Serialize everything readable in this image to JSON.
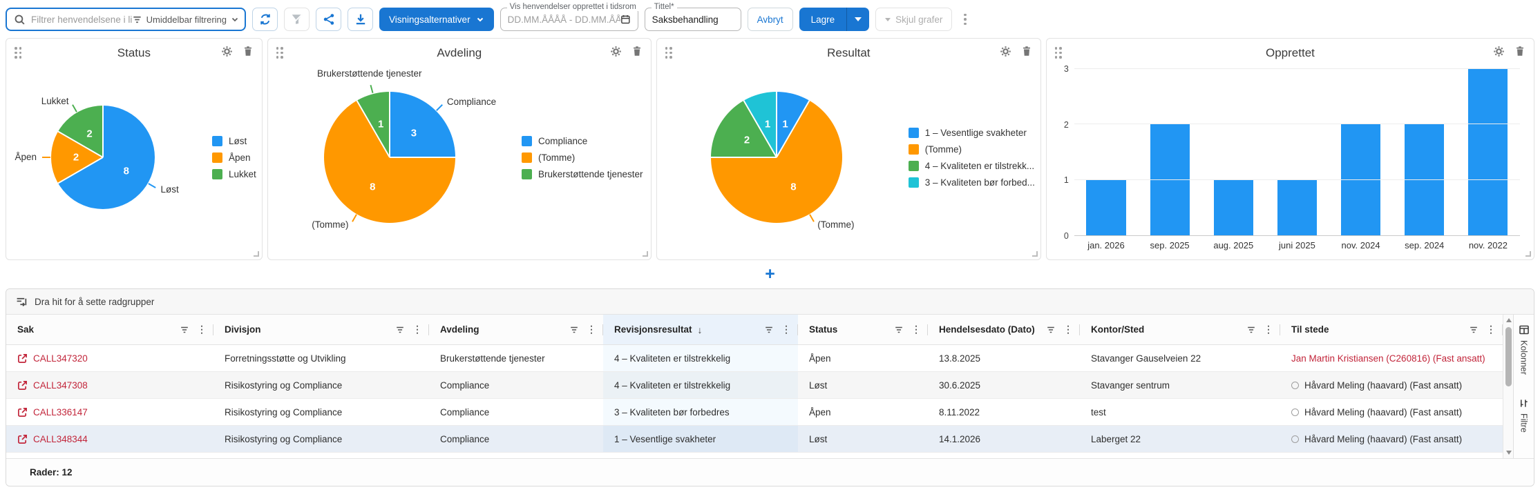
{
  "toolbar": {
    "search_placeholder": "Filtrer henvendelsene i listen...",
    "filter_mode_label": "Umiddelbar filtrering",
    "view_options_label": "Visningsalternativer",
    "date_range_label": "Vis henvendelser opprettet i tidsrom",
    "date_range_placeholder": "DD.MM.ÅÅÅÅ - DD.MM.ÅÅÅÅ",
    "title_label": "Tittel*",
    "title_value": "Saksbehandling",
    "cancel_label": "Avbryt",
    "save_label": "Lagre",
    "hide_charts_label": "Skjul grafer"
  },
  "add_chart_label": "+",
  "chart_data": [
    {
      "type": "pie",
      "title": "Status",
      "labels": [
        "Løst",
        "Åpen",
        "Lukket"
      ],
      "values": [
        8,
        2,
        2
      ],
      "colors": [
        "#2196f3",
        "#ff9800",
        "#4caf50"
      ],
      "callout_labels": [
        "Løst",
        "Åpen",
        "Lukket"
      ],
      "legend_position": "right"
    },
    {
      "type": "pie",
      "title": "Avdeling",
      "labels": [
        "Compliance",
        "(Tomme)",
        "Brukerstøttende tjenester"
      ],
      "values": [
        3,
        8,
        1
      ],
      "colors": [
        "#2196f3",
        "#ff9800",
        "#4caf50"
      ],
      "callout_labels": [
        "Compliance",
        "(Tomme)",
        "Brukerstøttende tjenester"
      ],
      "legend_position": "right"
    },
    {
      "type": "pie",
      "title": "Resultat",
      "labels": [
        "1 – Vesentlige svakheter",
        "(Tomme)",
        "4 – Kvaliteten er tilstrekk...",
        "3 – Kvaliteten bør forbed..."
      ],
      "values": [
        1,
        8,
        2,
        1
      ],
      "colors": [
        "#2196f3",
        "#ff9800",
        "#4caf50",
        "#1fc3d6"
      ],
      "callout_labels": [
        null,
        "(Tomme)",
        null,
        null
      ],
      "legend_position": "right"
    },
    {
      "type": "bar",
      "title": "Opprettet",
      "categories": [
        "jan. 2026",
        "sep. 2025",
        "aug. 2025",
        "juni 2025",
        "nov. 2024",
        "sep. 2024",
        "nov. 2022"
      ],
      "values": [
        1,
        2,
        1,
        1,
        2,
        2,
        3
      ],
      "bar_color": "#2196f3",
      "ylim": [
        0,
        3
      ],
      "yticks": [
        0,
        1,
        2,
        3
      ],
      "grid": true,
      "legend_position": "none"
    }
  ],
  "table": {
    "group_hint": "Dra hit for å sette radgrupper",
    "columns": [
      {
        "key": "sak",
        "label": "Sak"
      },
      {
        "key": "divisjon",
        "label": "Divisjon"
      },
      {
        "key": "avdeling",
        "label": "Avdeling"
      },
      {
        "key": "revisjonsresultat",
        "label": "Revisjonsresultat",
        "sorted": "desc"
      },
      {
        "key": "status",
        "label": "Status"
      },
      {
        "key": "hendelsesdato",
        "label": "Hendelsesdato (Dato)"
      },
      {
        "key": "kontor",
        "label": "Kontor/Sted"
      },
      {
        "key": "til_stede",
        "label": "Til stede"
      }
    ],
    "rows": [
      {
        "sak": "CALL347320",
        "divisjon": "Forretningsstøtte og Utvikling",
        "avdeling": "Brukerstøttende tjenester",
        "revisjonsresultat": "4 – Kvaliteten er tilstrekkelig",
        "status": "Åpen",
        "hendelsesdato": "13.8.2025",
        "kontor": "Stavanger Gauselveien 22",
        "til_stede": "Jan Martin Kristiansen (C260816) (Fast ansatt)",
        "til_stede_red": true,
        "presence_circle": false,
        "selected": false
      },
      {
        "sak": "CALL347308",
        "divisjon": "Risikostyring og Compliance",
        "avdeling": "Compliance",
        "revisjonsresultat": "4 – Kvaliteten er tilstrekkelig",
        "status": "Løst",
        "hendelsesdato": "30.6.2025",
        "kontor": "Stavanger sentrum",
        "til_stede": "Håvard Meling (haavard) (Fast ansatt)",
        "til_stede_red": false,
        "presence_circle": true,
        "selected": false
      },
      {
        "sak": "CALL336147",
        "divisjon": "Risikostyring og Compliance",
        "avdeling": "Compliance",
        "revisjonsresultat": "3 – Kvaliteten bør forbedres",
        "status": "Åpen",
        "hendelsesdato": "8.11.2022",
        "kontor": "test",
        "til_stede": "Håvard Meling (haavard) (Fast ansatt)",
        "til_stede_red": false,
        "presence_circle": true,
        "selected": false
      },
      {
        "sak": "CALL348344",
        "divisjon": "Risikostyring og Compliance",
        "avdeling": "Compliance",
        "revisjonsresultat": "1 – Vesentlige svakheter",
        "status": "Løst",
        "hendelsesdato": "14.1.2026",
        "kontor": "Laberget 22",
        "til_stede": "Håvard Meling (haavard) (Fast ansatt)",
        "til_stede_red": false,
        "presence_circle": true,
        "selected": true
      }
    ],
    "row_count_label": "Rader: 12"
  },
  "side_panel": {
    "tabs": [
      {
        "label": "Kolonner",
        "icon": "columns-icon"
      },
      {
        "label": "Filtre",
        "icon": "filter-icon"
      }
    ]
  },
  "colors": {
    "accent_blue": "#1976d2",
    "chart_blue": "#2196f3",
    "chart_orange": "#ff9800",
    "chart_green": "#4caf50",
    "chart_cyan": "#1fc3d6",
    "link_red": "#c2253a",
    "sorted_column_tint": "#eaf2fb"
  }
}
